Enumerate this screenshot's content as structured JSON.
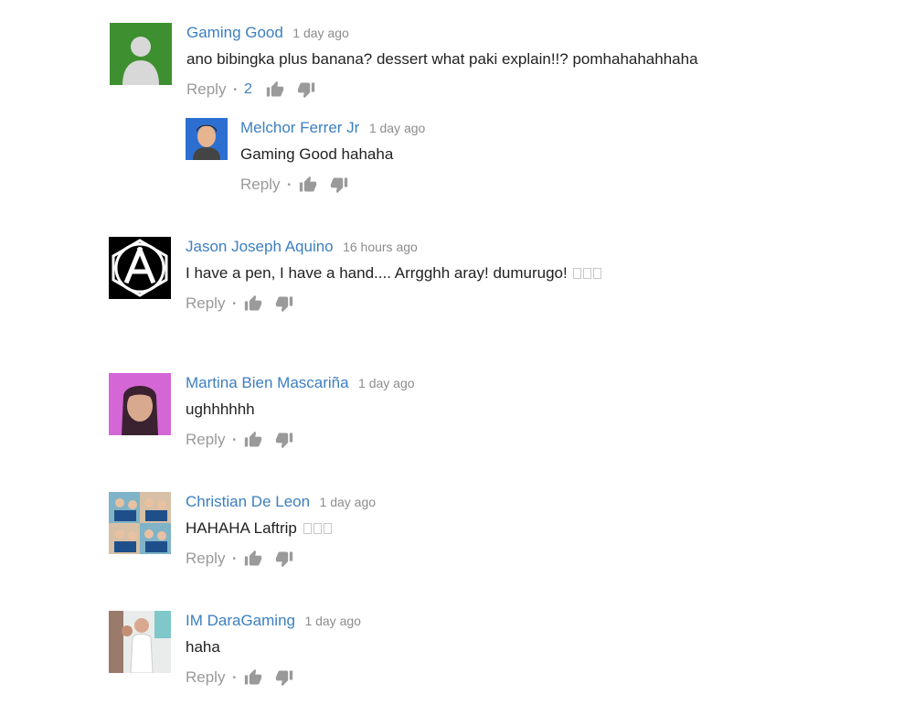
{
  "comments": [
    {
      "author": "Gaming Good",
      "time": "1 day ago",
      "text": "ano bibingka plus banana? dessert what paki explain!!? pomhahahahhaha",
      "reply": "Reply",
      "likes": "2"
    },
    {
      "author": "Melchor Ferrer Jr",
      "time": "1 day ago",
      "text": "Gaming Good hahaha",
      "reply": "Reply"
    },
    {
      "author": "Jason Joseph Aquino",
      "time": "16 hours ago",
      "text": "I have a pen, I have a hand.... Arrgghh aray! dumurugo!",
      "reply": "Reply"
    },
    {
      "author": "Martina Bien Mascariña",
      "time": "1 day ago",
      "text": "ughhhhhh",
      "reply": "Reply"
    },
    {
      "author": "Christian De Leon",
      "time": "1 day ago",
      "text": "HAHAHA Laftrip",
      "reply": "Reply"
    },
    {
      "author": "IM DaraGaming",
      "time": "1 day ago",
      "text": "haha",
      "reply": "Reply"
    }
  ],
  "icons": {
    "like": "thumbs-up-icon",
    "dislike": "thumbs-down-icon"
  },
  "colors": {
    "author": "#3c7fc1",
    "meta": "#8c8c8c",
    "likes": "#3c7fc1"
  }
}
